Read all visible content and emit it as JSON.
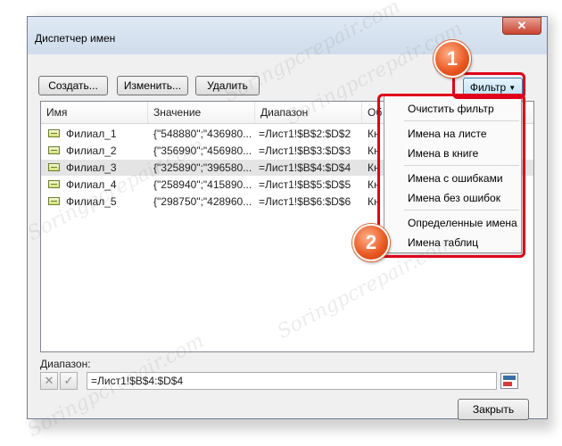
{
  "window": {
    "title": "Диспетчер имен"
  },
  "toolbar": {
    "create_label": "Создать...",
    "edit_label": "Изменить...",
    "delete_label": "Удалить",
    "filter_label": "Фильтр"
  },
  "table": {
    "headers": [
      "Имя",
      "Значение",
      "Диапазон",
      "Об"
    ],
    "rows": [
      {
        "name": "Филиал_1",
        "value": "{\"548880\";\"436980...",
        "range": "=Лист1!$B$2:$D$2",
        "scope": "Кн"
      },
      {
        "name": "Филиал_2",
        "value": "{\"356990\";\"456980...",
        "range": "=Лист1!$B$3:$D$3",
        "scope": "Кн"
      },
      {
        "name": "Филиал_3",
        "value": "{\"325890\";\"396580...",
        "range": "=Лист1!$B$4:$D$4",
        "scope": "Кн"
      },
      {
        "name": "Филиал_4",
        "value": "{\"258940\";\"415890...",
        "range": "=Лист1!$B$5:$D$5",
        "scope": "Кн"
      },
      {
        "name": "Филиал_5",
        "value": "{\"298750\";\"428960...",
        "range": "=Лист1!$B$6:$D$6",
        "scope": "Кн"
      }
    ]
  },
  "filter_menu": {
    "items": [
      "Очистить фильтр",
      "Имена на листе",
      "Имена в книге",
      "Имена с ошибками",
      "Имена без ошибок",
      "Определенные имена",
      "Имена таблиц"
    ]
  },
  "badges": {
    "one": "1",
    "two": "2"
  },
  "range": {
    "label": "Диапазон:",
    "value": "=Лист1!$B$4:$D$4"
  },
  "footer": {
    "close_label": "Закрыть"
  },
  "watermark": "Soringpcrepair.com",
  "colors": {
    "annotation_red": "#e0001a",
    "badge_orange": "#e8561f",
    "selected_row": "#e4e4e4"
  }
}
